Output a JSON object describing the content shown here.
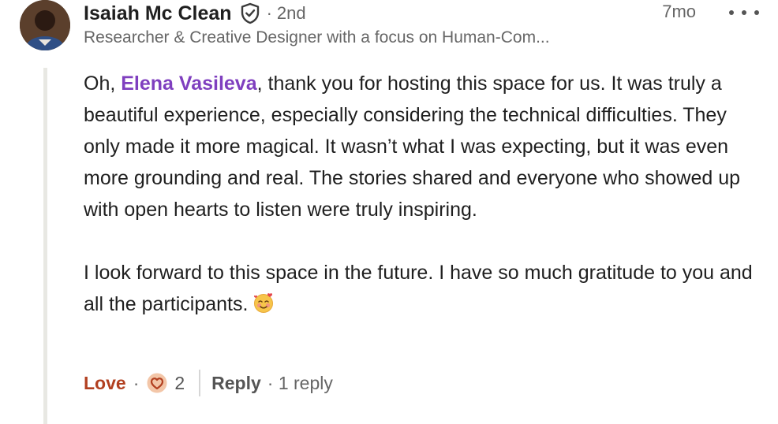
{
  "author": {
    "name": "Isaiah Mc Clean",
    "degree": "2nd",
    "separator": "·",
    "headline": "Researcher & Creative Designer with a focus on Human-Com...",
    "time_ago": "7mo"
  },
  "comment": {
    "paragraph1_lead": "Oh, ",
    "mention": "Elena Vasileva",
    "paragraph1_rest": ", thank you for hosting this space for us. It was truly a beautiful experience, especially considering the technical difficulties. They only made it more magical. It wasn’t what I was expecting, but it was even more grounding and real. The stories shared and everyone who showed up with open hearts to listen were truly inspiring.",
    "paragraph2": "I look forward to this space in the future. I have so much gratitude to you and all the participants."
  },
  "actions": {
    "love_label": "Love",
    "dot": "·",
    "reaction_count": "2",
    "reply_label": "Reply",
    "replies_text": "· 1 reply"
  },
  "colors": {
    "mention": "#7f3fbf",
    "love": "#b24020",
    "muted": "#666666",
    "thread_line": "#e8e8e3"
  },
  "icons": {
    "avatar": "profile-photo",
    "verified": "shield-check-icon",
    "more": "ellipsis-icon",
    "reaction": "love-heart-icon",
    "emoji": "smiling-face-with-hearts-icon"
  }
}
